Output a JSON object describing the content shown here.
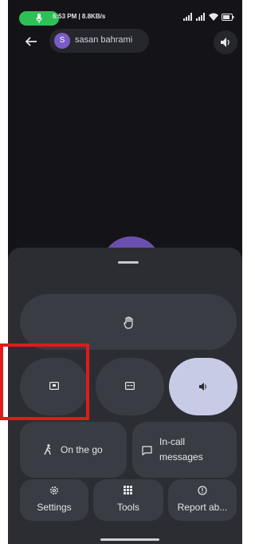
{
  "status_bar": {
    "time_and_speed": "6:53 PM | 8.8KB/s",
    "pill_color": "#2fbf57",
    "icons": [
      "mic-icon",
      "alarm-icon",
      "signal-icon",
      "signal-icon",
      "wifi-icon",
      "battery-icon"
    ]
  },
  "call_header": {
    "avatar_letter": "S",
    "contact_name": "sasan bahrami"
  },
  "sheet": {
    "hold_icon": "hand-icon",
    "controls": [
      {
        "name": "add-call-button",
        "icon": "screen-icon",
        "active": false
      },
      {
        "name": "captions-button",
        "icon": "captions-icon",
        "active": false
      },
      {
        "name": "speaker-button",
        "icon": "speaker-icon",
        "active": true
      }
    ],
    "on_the_go_label": "On the go",
    "in_call_messages_label_line1": "In-call",
    "in_call_messages_label_line2": "messages",
    "settings_label": "Settings",
    "tools_label": "Tools",
    "report_label": "Report ab..."
  },
  "colors": {
    "highlight": "#e01b1b",
    "active_button": "#c8cbe6",
    "sheet_bg": "#2b2d33"
  }
}
